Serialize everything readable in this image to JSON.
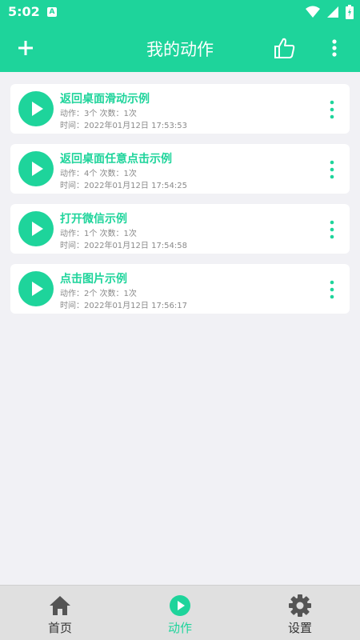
{
  "status_bar": {
    "time": "5:02",
    "a_badge": "A",
    "icons": [
      "wifi-icon",
      "signal-icon",
      "battery-icon"
    ]
  },
  "app_bar": {
    "title": "我的动作",
    "icons": [
      "plus-icon",
      "thumbs-up-icon",
      "more-vert-icon"
    ]
  },
  "actions": [
    {
      "title": "返回桌面滑动示例",
      "meta": "动作：3个 次数：1次",
      "time": "时间：2022年01月12日 17:53:53"
    },
    {
      "title": "返回桌面任意点击示例",
      "meta": "动作：4个 次数：1次",
      "time": "时间：2022年01月12日 17:54:25"
    },
    {
      "title": "打开微信示例",
      "meta": "动作：1个 次数：1次",
      "time": "时间：2022年01月12日 17:54:58"
    },
    {
      "title": "点击图片示例",
      "meta": "动作：2个 次数：1次",
      "time": "时间：2022年01月12日 17:56:17"
    }
  ],
  "bottom_nav": {
    "items": [
      {
        "label": "首页",
        "icon": "home-icon",
        "active": false
      },
      {
        "label": "动作",
        "icon": "play-circle-icon",
        "active": true
      },
      {
        "label": "设置",
        "icon": "gear-icon",
        "active": false
      }
    ]
  },
  "colors": {
    "accent": "#1ed49b",
    "background": "#f1f1f5",
    "nav_background": "#e0e0e0",
    "meta_text": "#8a8a8a"
  }
}
